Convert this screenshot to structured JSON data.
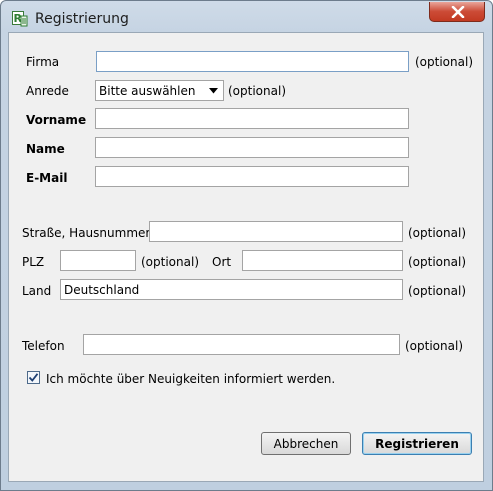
{
  "window": {
    "title": "Registrierung",
    "icons": {
      "app": "app-logo-icon",
      "close": "close-icon"
    }
  },
  "form": {
    "firma_label": "Firma",
    "firma_value": "",
    "anrede_label": "Anrede",
    "anrede_selected": "Bitte auswählen",
    "vorname_label": "Vorname",
    "vorname_value": "",
    "name_label": "Name",
    "name_value": "",
    "email_label": "E-Mail",
    "email_value": "",
    "strasse_label": "Straße, Hausnummer",
    "strasse_value": "",
    "plz_label": "PLZ",
    "plz_value": "",
    "ort_label": "Ort",
    "ort_value": "",
    "land_label": "Land",
    "land_value": "Deutschland",
    "telefon_label": "Telefon",
    "telefon_value": "",
    "optional_hint": "(optional)",
    "newsletter_label": "Ich möchte über Neuigkeiten informiert werden.",
    "newsletter_checked": true
  },
  "buttons": {
    "cancel": "Abbrechen",
    "submit": "Registrieren"
  },
  "colors": {
    "titlebar": "#c6d4e3",
    "client_bg": "#f0f0f0",
    "close_button": "#c94a33",
    "default_button_border": "#3c7fb1"
  }
}
